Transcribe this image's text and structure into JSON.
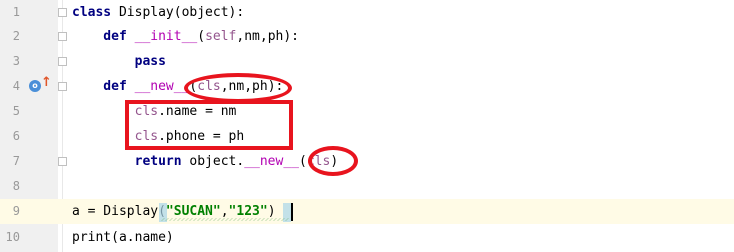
{
  "editor": {
    "lines": [
      {
        "num": "1",
        "tokens": [
          {
            "t": "class ",
            "c": "kw"
          },
          {
            "t": "Display(object):",
            "c": ""
          }
        ]
      },
      {
        "num": "2",
        "tokens": [
          {
            "t": "    def ",
            "c": "kw"
          },
          {
            "t": "__init__",
            "c": "dunder"
          },
          {
            "t": "(",
            "c": ""
          },
          {
            "t": "self",
            "c": "self"
          },
          {
            "t": ",nm,ph):",
            "c": ""
          }
        ]
      },
      {
        "num": "3",
        "tokens": [
          {
            "t": "        pass",
            "c": "kw"
          }
        ]
      },
      {
        "num": "4",
        "tokens": [
          {
            "t": "    def ",
            "c": "kw"
          },
          {
            "t": "__new__",
            "c": "dunder"
          },
          {
            "t": "(",
            "c": ""
          },
          {
            "t": "cls",
            "c": "self"
          },
          {
            "t": ",nm,ph):",
            "c": ""
          }
        ]
      },
      {
        "num": "5",
        "tokens": [
          {
            "t": "        ",
            "c": ""
          },
          {
            "t": "cls",
            "c": "self"
          },
          {
            "t": ".name = nm",
            "c": ""
          }
        ]
      },
      {
        "num": "6",
        "tokens": [
          {
            "t": "        ",
            "c": ""
          },
          {
            "t": "cls",
            "c": "self"
          },
          {
            "t": ".phone = ph",
            "c": ""
          }
        ]
      },
      {
        "num": "7",
        "tokens": [
          {
            "t": "        return ",
            "c": "kw"
          },
          {
            "t": "object.",
            "c": ""
          },
          {
            "t": "__new__",
            "c": "dunder"
          },
          {
            "t": "(",
            "c": ""
          },
          {
            "t": "cls",
            "c": "self"
          },
          {
            "t": ")",
            "c": ""
          }
        ]
      },
      {
        "num": "8",
        "tokens": []
      },
      {
        "num": "9",
        "current": true,
        "tokens": [
          {
            "t": "a = Display(",
            "c": ""
          },
          {
            "t": "\"SUCAN\"",
            "c": "str"
          },
          {
            "t": ",",
            "c": ""
          },
          {
            "t": "\"123\"",
            "c": "str"
          },
          {
            "t": ")",
            "c": ""
          }
        ]
      },
      {
        "num": "10",
        "tokens": [
          {
            "t": "print(a.name)",
            "c": ""
          }
        ]
      }
    ]
  },
  "icons": {
    "override": "override-method-icon",
    "override_arrow": "up-arrow-icon"
  },
  "colors": {
    "annotation": "#e8141e",
    "keyword": "#000080",
    "self_param": "#94558d",
    "dunder": "#b200b2",
    "string": "#008000"
  }
}
